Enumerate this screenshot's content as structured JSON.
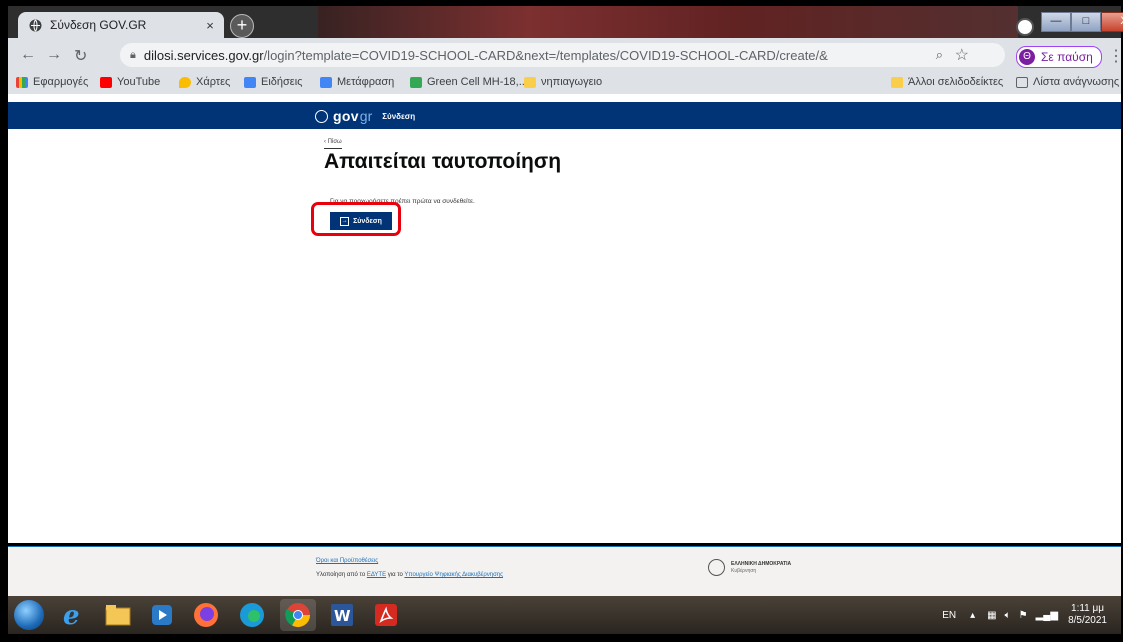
{
  "browser": {
    "tab_title": "Σύνδεση GOV.GR",
    "tab_close": "×",
    "new_tab": "+",
    "url_host": "dilosi.services.gov.gr",
    "url_rest": "/login?template=COVID19-SCHOOL-CARD&next=/templates/COVID19-SCHOOL-CARD/create/&",
    "profile_initial": "Θ",
    "profile_status": "Σε παύση",
    "window_controls": [
      "—",
      "□",
      "X"
    ]
  },
  "bookmarks": {
    "items": [
      {
        "label": "Εφαρμογές",
        "color": "#ea4335"
      },
      {
        "label": "YouTube",
        "color": "#ff0000"
      },
      {
        "label": "Χάρτες",
        "color": "#fbbc04"
      },
      {
        "label": "Ειδήσεις",
        "color": "#4285f4"
      },
      {
        "label": "Μετάφραση",
        "color": "#4285f4"
      },
      {
        "label": "Green Cell MH-18,...",
        "color": "#34a853"
      },
      {
        "label": "νηπιαγωγειο",
        "color": "#f9ce4b"
      }
    ],
    "other": "Άλλοι σελιδοδείκτες",
    "reading_list": "Λίστα ανάγνωσης"
  },
  "page": {
    "header": {
      "logo_gov": "gov",
      "logo_gr": "gr",
      "link": "Σύνδεση"
    },
    "back": "‹ Πίσω",
    "title": "Απαιτείται ταυτοποίηση",
    "description": "Για να προχωρήσετε πρέπει πρώτα να συνδεθείτε.",
    "login_button": "Σύνδεση",
    "footer": {
      "terms": "Όροι και Προϋποθέσεις",
      "impl_prefix": "Υλοποίηση από το ",
      "impl_grnet": "ΕΔΥΤΕ",
      "impl_mid": " για το ",
      "impl_ministry": "Υπουργείο Ψηφιακής Διακυβέρνησης",
      "brand_title": "ΕΛΛΗΝΙΚΗ ΔΗΜΟΚΡΑΤΙΑ",
      "brand_sub": "Κυβέρνηση"
    }
  },
  "taskbar": {
    "lang": "EN",
    "time": "1:11 μμ",
    "date": "8/5/2021"
  }
}
